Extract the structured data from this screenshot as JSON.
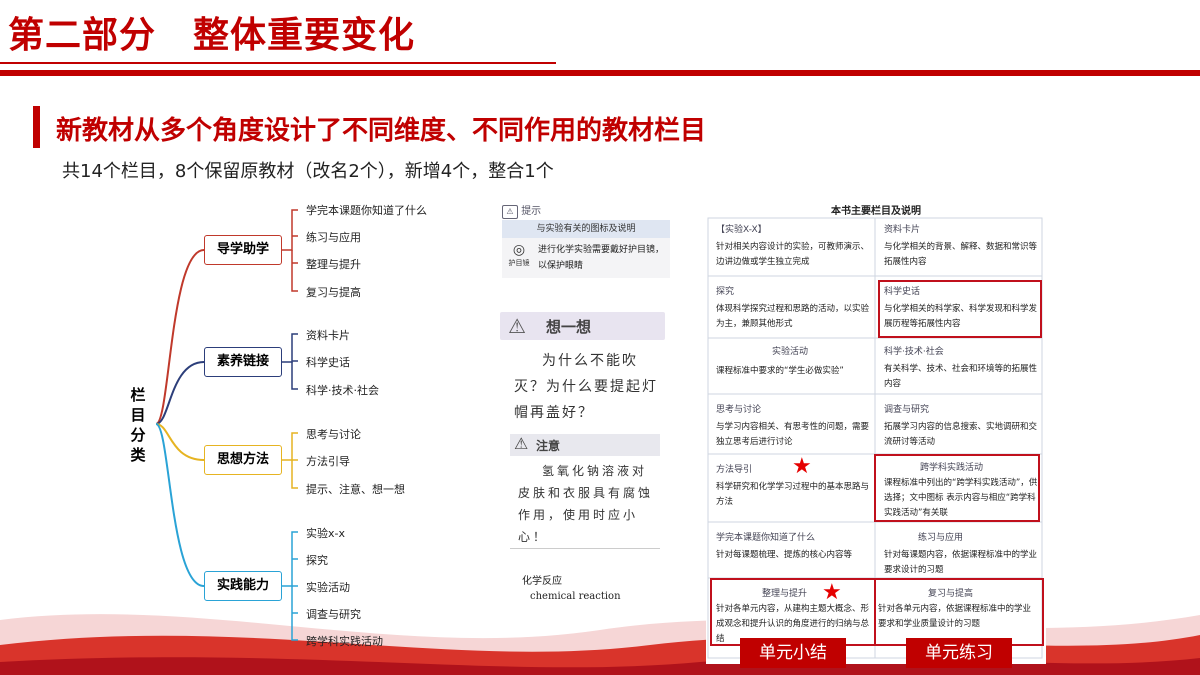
{
  "header": {
    "title": "第二部分　整体重要变化"
  },
  "section": {
    "subtitle": "新教材从多个角度设计了不同维度、不同作用的教材栏目",
    "summary": "共14个栏目，8个保留原教材（改名2个），新增4个，整合1个"
  },
  "mindmap": {
    "root": "栏目分类",
    "categories": [
      {
        "name": "导学助学",
        "leaves": [
          "学完本课题你知道了什么",
          "练习与应用",
          "整理与提升",
          "复习与提高"
        ],
        "color": "#c0392b"
      },
      {
        "name": "素养链接",
        "leaves": [
          "资料卡片",
          "科学史话",
          "科学·技术·社会"
        ],
        "color": "#2c3e7a"
      },
      {
        "name": "思想方法",
        "leaves": [
          "思考与讨论",
          "方法引导",
          "提示、注意、想一想"
        ],
        "color": "#e6b422"
      },
      {
        "name": "实践能力",
        "leaves": [
          "实验x-x",
          "探究",
          "实验活动",
          "调查与研究",
          "跨学科实践活动"
        ],
        "color": "#2aa3d6"
      }
    ]
  },
  "middle_panel": {
    "tip_label": "提示",
    "tip_header": "与实验有关的图标及说明",
    "tip_icon_label": "护目镜",
    "tip_text": "进行化学实验需要戴好护目镜，以保护眼睛",
    "think_label": "想一想",
    "think_text": "为什么不能吹灭？为什么要提起灯帽再盖好？",
    "caution_label": "注意",
    "caution_text": "氢氧化钠溶液对皮肤和衣服具有腐蚀作用，使用时应小心！",
    "term_cn": "化学反应",
    "term_en": "chemical reaction"
  },
  "right_panel": {
    "title": "本书主要栏目及说明",
    "cells": [
      {
        "h": "【实验X-X】",
        "t": "针对相关内容设计的实验，可教师演示、边讲边做或学生独立完成"
      },
      {
        "h": "资料卡片",
        "t": "与化学相关的背景、解释、数据和常识等拓展性内容"
      },
      {
        "h": "探究",
        "t": "体现科学探究过程和思路的活动，以实验为主，兼顾其他形式"
      },
      {
        "h": "科学史话",
        "t": "与化学相关的科学家、科学发现和科学发展历程等拓展性内容"
      },
      {
        "h": "实验活动",
        "t": "课程标准中要求的“学生必做实验”"
      },
      {
        "h": "科学·技术·社会",
        "t": "有关科学、技术、社会和环境等的拓展性内容"
      },
      {
        "h": "思考与讨论",
        "t": "与学习内容相关、有思考性的问题，需要独立思考后进行讨论"
      },
      {
        "h": "调查与研究",
        "t": "拓展学习内容的信息搜索、实地调研和交流研讨等活动"
      },
      {
        "h": "方法导引",
        "t": "科学研究和化学学习过程中的基本思路与方法"
      },
      {
        "h": "跨学科实践活动",
        "t": "课程标准中列出的“跨学科实践活动”，供选择；文中图标 表示内容与相应“跨学科实践活动”有关联"
      },
      {
        "h": "学完本课题你知道了什么",
        "t": "针对每课题梳理、提炼的核心内容等"
      },
      {
        "h": "练习与应用",
        "t": "针对每课题内容，依据课程标准中的学业要求设计的习题"
      },
      {
        "h": "整理与提升",
        "t": "针对各单元内容，从建构主题大概念、形成观念和提升认识的角度进行的归纳与总结"
      },
      {
        "h": "复习与提高",
        "t": "针对各单元内容，依据课程标准中的学业要求和学业质量设计的习题"
      }
    ],
    "tag_left": "单元小结",
    "tag_right": "单元练习"
  },
  "colors": {
    "accent": "#c00000"
  }
}
